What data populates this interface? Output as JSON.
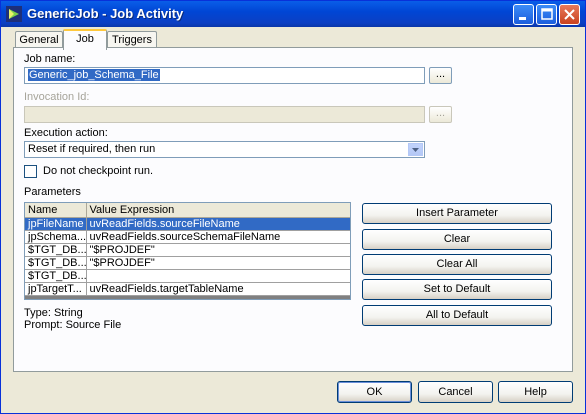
{
  "window": {
    "title": "GenericJob - Job Activity"
  },
  "tabs": [
    {
      "label": "General"
    },
    {
      "label": "Job"
    },
    {
      "label": "Triggers"
    }
  ],
  "job_name": {
    "label": "Job name:",
    "value": "Generic_job_Schema_File",
    "browse_label": "..."
  },
  "invocation_id": {
    "label": "Invocation Id:",
    "value": "",
    "browse_label": "..."
  },
  "execution_action": {
    "label": "Execution action:",
    "selected": "Reset if required, then run"
  },
  "checkpoint": {
    "label": "Do not checkpoint run.",
    "checked": false
  },
  "parameters": {
    "label": "Parameters",
    "columns": [
      "Name",
      "Value Expression"
    ],
    "rows": [
      {
        "name": "jpFileName",
        "value": "uvReadFields.sourceFileName",
        "selected": true
      },
      {
        "name": "jpSchema...",
        "value": "uvReadFields.sourceSchemaFileName",
        "selected": false
      },
      {
        "name": "$TGT_DB...",
        "value": "\"$PROJDEF\"",
        "selected": false
      },
      {
        "name": "$TGT_DB...",
        "value": "\"$PROJDEF\"",
        "selected": false
      },
      {
        "name": "$TGT_DB...",
        "value": "",
        "selected": false
      },
      {
        "name": "jpTargetT...",
        "value": "uvReadFields.targetTableName",
        "selected": false
      }
    ],
    "type_text": "Type: String",
    "prompt_text": "Prompt: Source File"
  },
  "param_buttons": {
    "insert": "Insert Parameter",
    "clear": "Clear",
    "clear_all": "Clear All",
    "set_default": "Set to Default",
    "all_default": "All to Default"
  },
  "footer": {
    "ok": "OK",
    "cancel": "Cancel",
    "help": "Help"
  }
}
